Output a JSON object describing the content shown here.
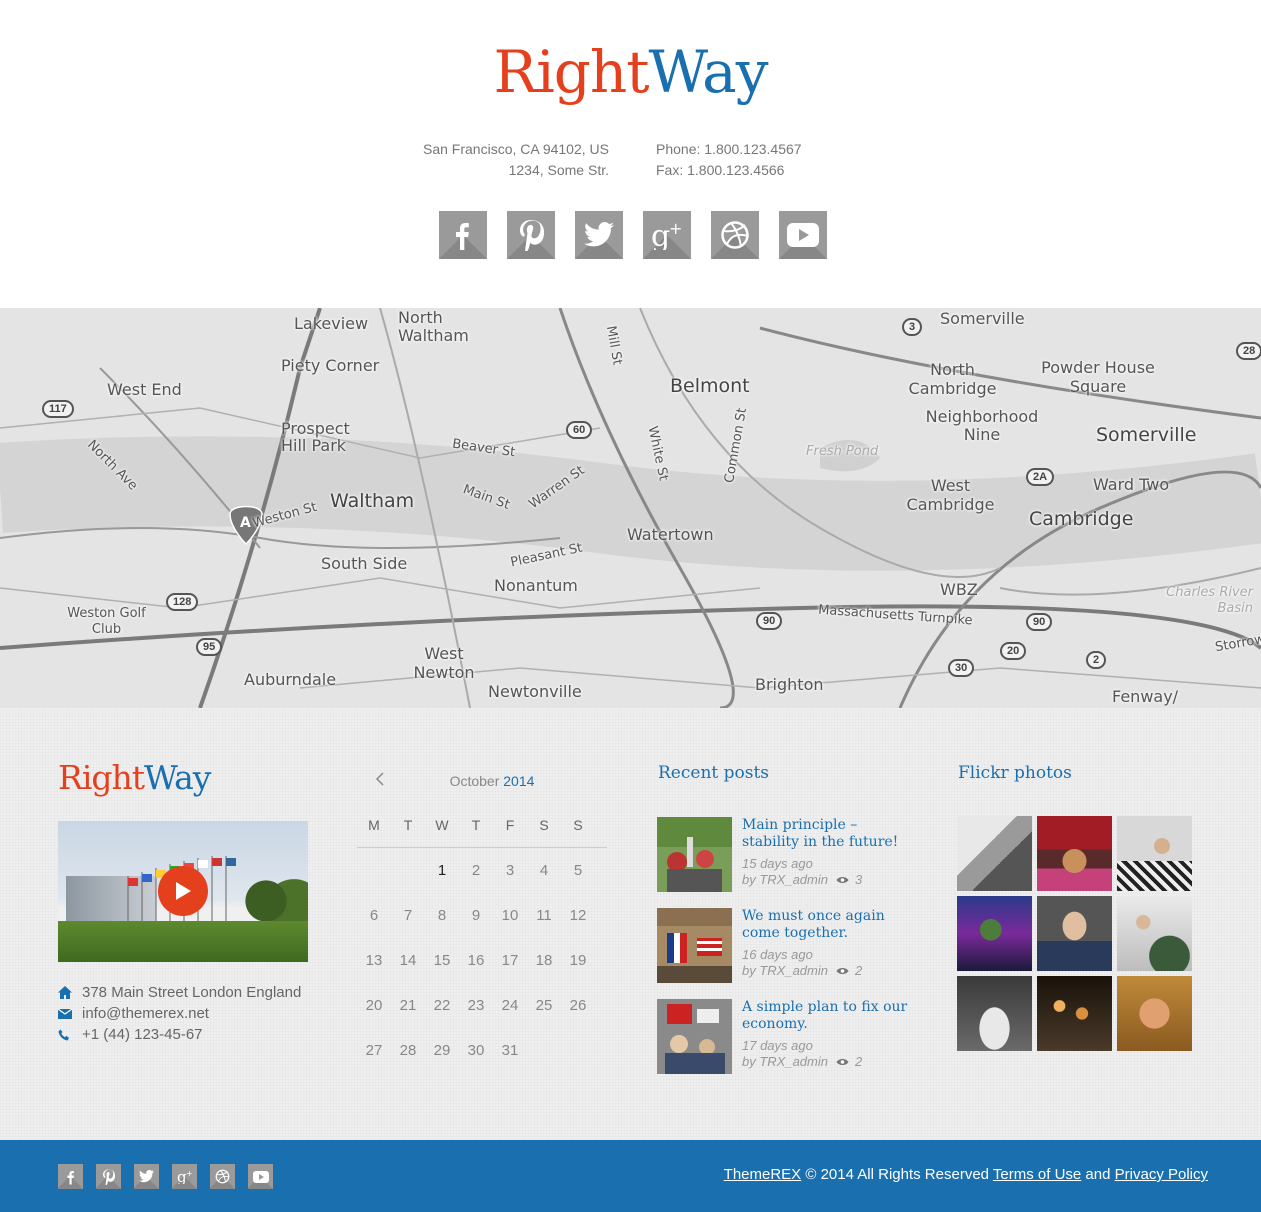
{
  "brand": {
    "part1": "Right",
    "part2": "Way",
    "color1": "#e5401e",
    "color2": "#1a6faf"
  },
  "header": {
    "address_line1": "San Francisco, CA 94102, US",
    "address_line2": "1234, Some Str.",
    "phone": "Phone: 1.800.123.4567",
    "fax": "Fax: 1.800.123.4566"
  },
  "socials": [
    "facebook-icon",
    "pinterest-icon",
    "twitter-icon",
    "google-plus-icon",
    "dribbble-icon",
    "youtube-icon"
  ],
  "map": {
    "labels": [
      "Lakeview",
      "North Waltham",
      "Somerville",
      "Piety Corner",
      "Belmont",
      "North Cambridge",
      "Powder House Square",
      "West End",
      "Prospect Hill Park",
      "Neighborhood Nine",
      "Somerville",
      "Beaver St",
      "Fresh Pond",
      "Waltham",
      "Main St",
      "Warren St",
      "West Cambridge",
      "Ward Two",
      "Cambridge",
      "Watertown",
      "South Side",
      "Pleasant St",
      "Nonantum",
      "WBZ",
      "Weston Golf Club",
      "Massachusetts Turnpike",
      "Charles River Basin",
      "West Newton",
      "Auburndale",
      "Newtonville",
      "Brighton",
      "Fenway/",
      "Mill St",
      "White St",
      "Common St",
      "North Ave",
      "Weston St",
      "Storrow"
    ],
    "shields": [
      "3",
      "117",
      "60",
      "2A",
      "128",
      "95",
      "90",
      "90",
      "20",
      "30",
      "2",
      "28"
    ],
    "marker": "A"
  },
  "footer": {
    "contact": {
      "address": "378 Main Street London England",
      "email": "info@themerex.net",
      "phone": "+1 (44) 123-45-67"
    },
    "calendar": {
      "month": "October",
      "year": "2014",
      "weekdays": [
        "M",
        "T",
        "W",
        "T",
        "F",
        "S",
        "S"
      ],
      "weeks": [
        [
          "",
          "",
          "1",
          "2",
          "3",
          "4",
          "5"
        ],
        [
          "6",
          "7",
          "8",
          "9",
          "10",
          "11",
          "12"
        ],
        [
          "13",
          "14",
          "15",
          "16",
          "17",
          "18",
          "19"
        ],
        [
          "20",
          "21",
          "22",
          "23",
          "24",
          "25",
          "26"
        ],
        [
          "27",
          "28",
          "29",
          "30",
          "31",
          "",
          ""
        ]
      ],
      "today": "1"
    },
    "recent_posts": {
      "title": "Recent posts",
      "items": [
        {
          "title": "Main principle – stability in the future!",
          "date": "15 days ago",
          "author": "by TRX_admin",
          "views": "3"
        },
        {
          "title": "We must once again come together.",
          "date": "16 days ago",
          "author": "by TRX_admin",
          "views": "2"
        },
        {
          "title": "A simple plan to fix our economy.",
          "date": "17 days ago",
          "author": "by TRX_admin",
          "views": "2"
        }
      ]
    },
    "flickr": {
      "title": "Flickr photos",
      "count": 9
    }
  },
  "bottom": {
    "brand_link": "ThemeREX",
    "copyright": " © 2014 All Rights Reserved ",
    "terms": "Terms of Use",
    "and": " and ",
    "privacy": "Privacy Policy"
  }
}
